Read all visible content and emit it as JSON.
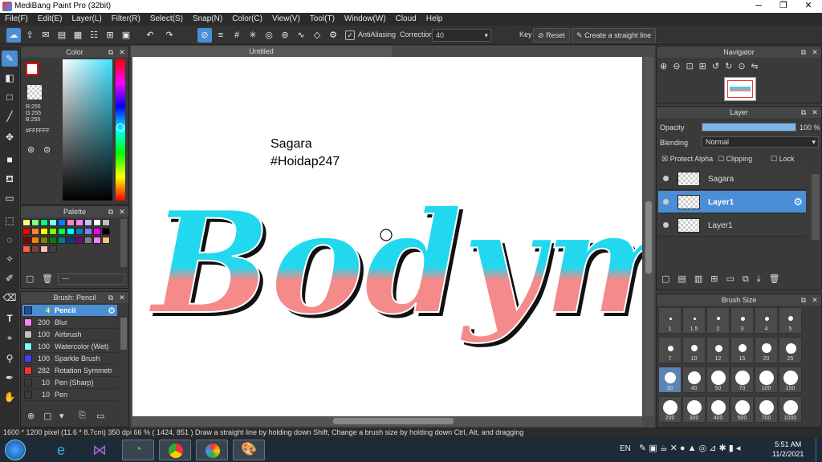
{
  "app": {
    "title": "MediBang Paint Pro (32bit)"
  },
  "menu": [
    "File(F)",
    "Edit(E)",
    "Layer(L)",
    "Filter(R)",
    "Select(S)",
    "Snap(N)",
    "Color(C)",
    "View(V)",
    "Tool(T)",
    "Window(W)",
    "Cloud",
    "Help"
  ],
  "toolbar": {
    "antialias_label": "AntiAliasing",
    "correction_label": "Correction",
    "correction_value": "40",
    "key_label": "Key",
    "reset_label": "Reset",
    "straight_line_label": "Create a straight line"
  },
  "color_panel": {
    "title": "Color",
    "r": "R:255",
    "g": "G:255",
    "b": "B:255",
    "hex": "#FFFFFF"
  },
  "palette_panel": {
    "title": "Palette",
    "footer": "---",
    "colors": [
      "#ffff80",
      "#80ff80",
      "#00ff80",
      "#80ffff",
      "#0080ff",
      "#ff80c0",
      "#ff80ff",
      "#c0c0ff",
      "#ffffff",
      "#c0c0c0",
      "#ff0000",
      "#ff8040",
      "#ffff00",
      "#80ff00",
      "#00ff40",
      "#00ffff",
      "#0080c0",
      "#8080ff",
      "#ff00ff",
      "#000000",
      "#800000",
      "#ff8000",
      "#808000",
      "#008000",
      "#008080",
      "#004080",
      "#800080",
      "#808080",
      "#ff80ff",
      "#ffc080",
      "#ff6040",
      "#804040",
      "#ffc0c0",
      "#404040"
    ]
  },
  "brush_panel": {
    "title": "Brush: Pencil",
    "brushes": [
      {
        "size": "4",
        "name": "Pencil",
        "color": "#1a4fa0"
      },
      {
        "size": "200",
        "name": "Blur",
        "color": "#ff80ff"
      },
      {
        "size": "100",
        "name": "Airbrush",
        "color": "#c0c0c0"
      },
      {
        "size": "100",
        "name": "Watercolor (Wet)",
        "color": "#80ffff"
      },
      {
        "size": "100",
        "name": "Sparkle Brush",
        "color": "#4040ff"
      },
      {
        "size": "282",
        "name": "Rotation Symmetr",
        "color": "#ff3030"
      },
      {
        "size": "10",
        "name": "Pen (Sharp)",
        "color": "#3a3a3a"
      },
      {
        "size": "10",
        "name": "Pen",
        "color": "#3a3a3a"
      }
    ]
  },
  "canvas": {
    "tab": "Untitled",
    "text_line1": "Sagara",
    "text_line2": "#Hoidap247",
    "art_word": "Bodyme"
  },
  "navigator": {
    "title": "Navigator"
  },
  "layer_panel": {
    "title": "Layer",
    "opacity_label": "Opacity",
    "opacity_value": "100 %",
    "opacity": 1.0,
    "blending_label": "Blending",
    "blending_value": "Normal",
    "protect_alpha": "Protect Alpha",
    "clipping": "Clipping",
    "lock": "Lock",
    "layers": [
      {
        "name": "Sagara"
      },
      {
        "name": "Layer1"
      },
      {
        "name": "Layer1"
      }
    ]
  },
  "brush_size_panel": {
    "title": "Brush Size",
    "sizes": [
      "1",
      "1.5",
      "2",
      "3",
      "4",
      "5",
      "7",
      "10",
      "12",
      "15",
      "20",
      "25",
      "30",
      "40",
      "50",
      "70",
      "100",
      "150",
      "200",
      "300",
      "400",
      "500",
      "700",
      "1000"
    ]
  },
  "status": {
    "text": "1600 * 1200 pixel   (11.6 * 8.7cm)   350 dpi   66 %   ( 1424, 851 )   Draw a straight line by holding down Shift, Change a brush size by holding down Ctrl, Alt, and dragging"
  },
  "taskbar": {
    "lang": "EN",
    "time": "5:51 AM",
    "date": "11/2/2021"
  }
}
